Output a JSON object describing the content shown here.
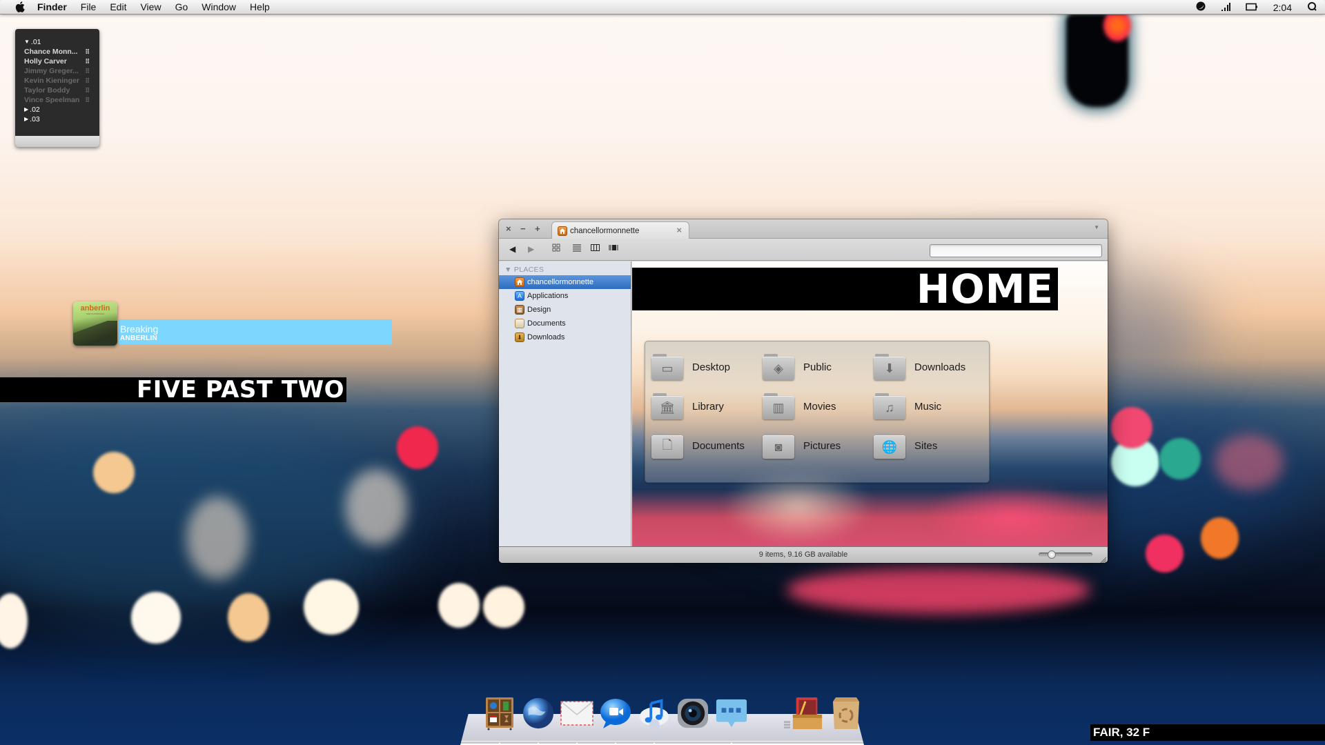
{
  "menubar": {
    "app_name": "Finder",
    "menus": [
      "File",
      "Edit",
      "View",
      "Go",
      "Window",
      "Help"
    ],
    "status_icons": [
      "moon-icon",
      "signal-bars-icon",
      "battery-icon"
    ],
    "clock": "2:04",
    "spotlight_icon": "spotlight-search-icon"
  },
  "contacts_widget": {
    "groups": [
      {
        "label": ".01",
        "expanded": true,
        "people": [
          {
            "name": "Chance Monn...",
            "active": true
          },
          {
            "name": "Holly Carver",
            "active": true
          },
          {
            "name": "Jimmy Greger...",
            "active": false
          },
          {
            "name": "Kevin Kieninger",
            "active": false
          },
          {
            "name": "Taylor Boddy",
            "active": false
          },
          {
            "name": "Vince Speelman",
            "active": false
          }
        ]
      },
      {
        "label": ".02",
        "expanded": false
      },
      {
        "label": ".03",
        "expanded": false
      }
    ]
  },
  "now_playing": {
    "album_art_text": "anberlin",
    "album_art_subtext": "NEW SURRENDER",
    "track": "Breaking",
    "artist": "ANBERLIN",
    "accent_color": "#7dd6fd"
  },
  "clock_words": "FIVE PAST TWO",
  "weather": "FAIR, 32 F",
  "finder": {
    "tab_title": "chancellormonnette",
    "window_controls": [
      "close",
      "minimize",
      "zoom"
    ],
    "toolbar": {
      "back_icon": "back-arrow-icon",
      "forward_icon": "forward-arrow-icon",
      "view_modes": [
        "icon-view",
        "list-view",
        "column-view",
        "cover-flow-view"
      ]
    },
    "search": {
      "value": "",
      "placeholder": ""
    },
    "sidebar": {
      "section": "PLACES",
      "items": [
        {
          "label": "chancellormonnette",
          "icon": "home-icon",
          "selected": true
        },
        {
          "label": "Applications",
          "icon": "applications-icon",
          "selected": false
        },
        {
          "label": "Design",
          "icon": "design-folder-icon",
          "selected": false
        },
        {
          "label": "Documents",
          "icon": "documents-icon",
          "selected": false
        },
        {
          "label": "Downloads",
          "icon": "downloads-icon",
          "selected": false
        }
      ]
    },
    "banner": "HOME",
    "folders": [
      {
        "label": "Desktop",
        "icon": "desktop-folder-icon",
        "glyph": "▭"
      },
      {
        "label": "Public",
        "icon": "public-folder-icon",
        "glyph": "◈"
      },
      {
        "label": "Downloads",
        "icon": "downloads-folder-icon",
        "glyph": "⬇"
      },
      {
        "label": "Library",
        "icon": "library-folder-icon",
        "glyph": "🏛"
      },
      {
        "label": "Movies",
        "icon": "movies-folder-icon",
        "glyph": "▥"
      },
      {
        "label": "Music",
        "icon": "music-folder-icon",
        "glyph": "♫"
      },
      {
        "label": "Documents",
        "icon": "documents-folder-icon",
        "glyph": "🗋"
      },
      {
        "label": "Pictures",
        "icon": "pictures-folder-icon",
        "glyph": "◙"
      },
      {
        "label": "Sites",
        "icon": "sites-folder-icon",
        "glyph": "🌐"
      }
    ],
    "status": "9 items, 9.16 GB available",
    "icon_size_slider": 0.2
  },
  "dock": {
    "items": [
      {
        "name": "books-shelf",
        "running": true
      },
      {
        "name": "safari-globe",
        "running": true
      },
      {
        "name": "mail",
        "running": true
      },
      {
        "name": "facetime",
        "running": true
      },
      {
        "name": "itunes",
        "running": true
      },
      {
        "name": "camera",
        "running": false
      },
      {
        "name": "messages",
        "running": true
      },
      {
        "name": "applications-stack",
        "running": false
      },
      {
        "name": "trash",
        "running": false
      }
    ]
  }
}
